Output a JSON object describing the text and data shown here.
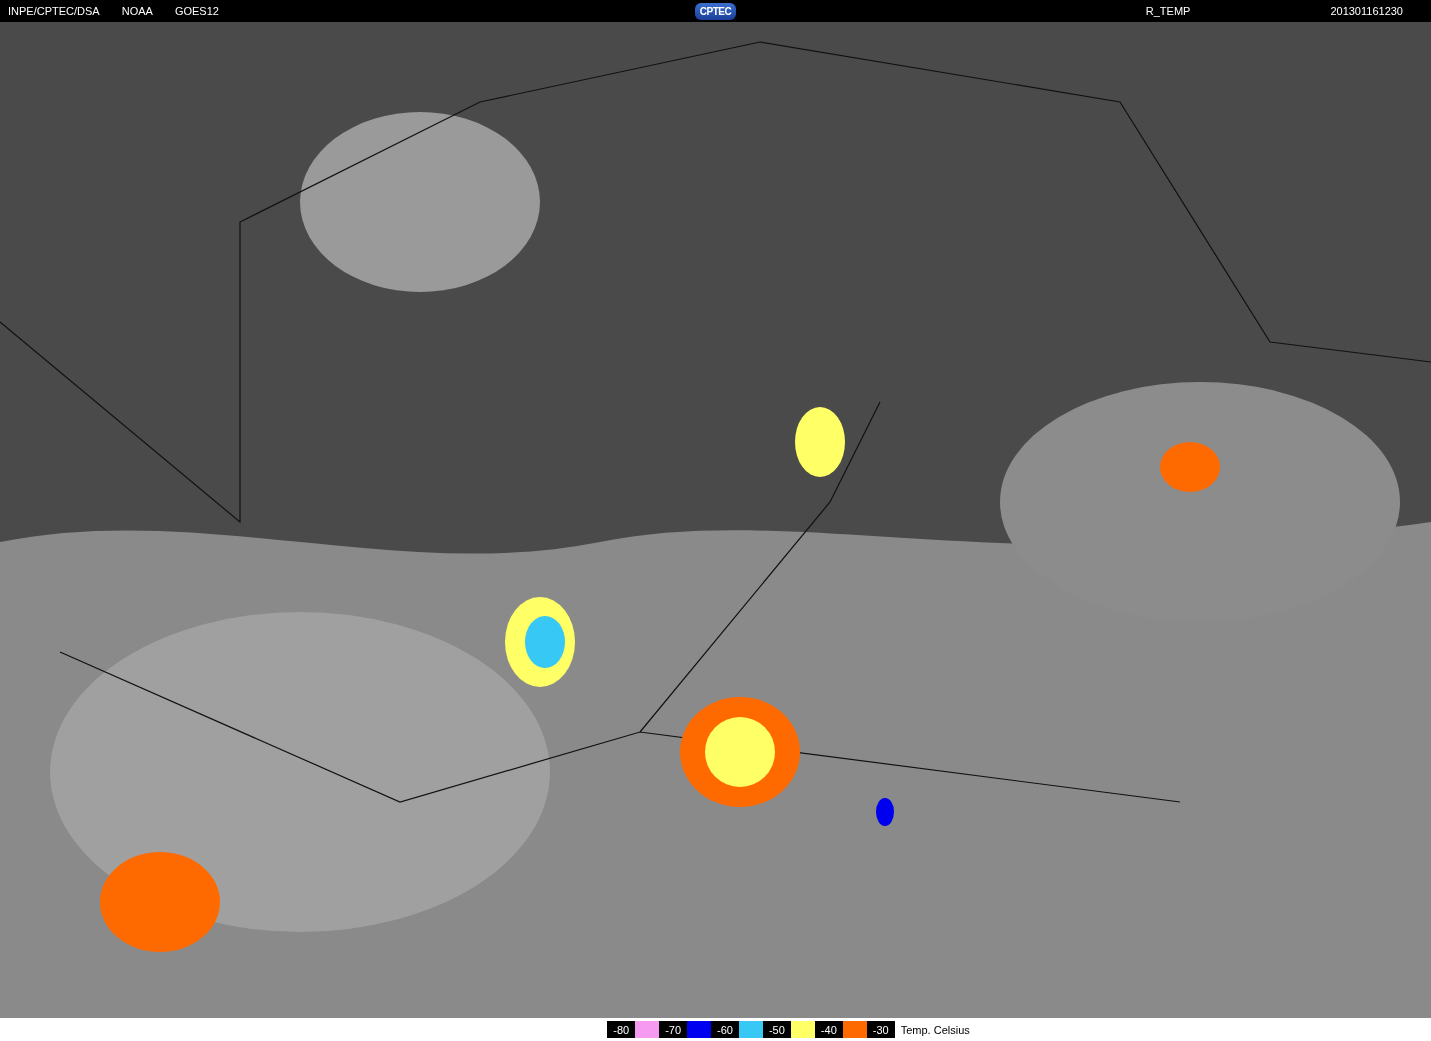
{
  "header": {
    "left": [
      "INPE/CPTEC/DSA",
      "NOAA",
      "GOES12"
    ],
    "logo": "CPTEC",
    "product": "R_TEMP",
    "timestamp": "201301161230"
  },
  "legend": {
    "steps": [
      {
        "label": "-80",
        "color": "#f59af0"
      },
      {
        "label": "-70",
        "color": "#0000f0"
      },
      {
        "label": "-60",
        "color": "#38c8f5"
      },
      {
        "label": "-50",
        "color": "#ffff66"
      },
      {
        "label": "-40",
        "color": "#ff6a00"
      },
      {
        "label": "-30"
      }
    ],
    "unit": "Temp. Celsius"
  }
}
